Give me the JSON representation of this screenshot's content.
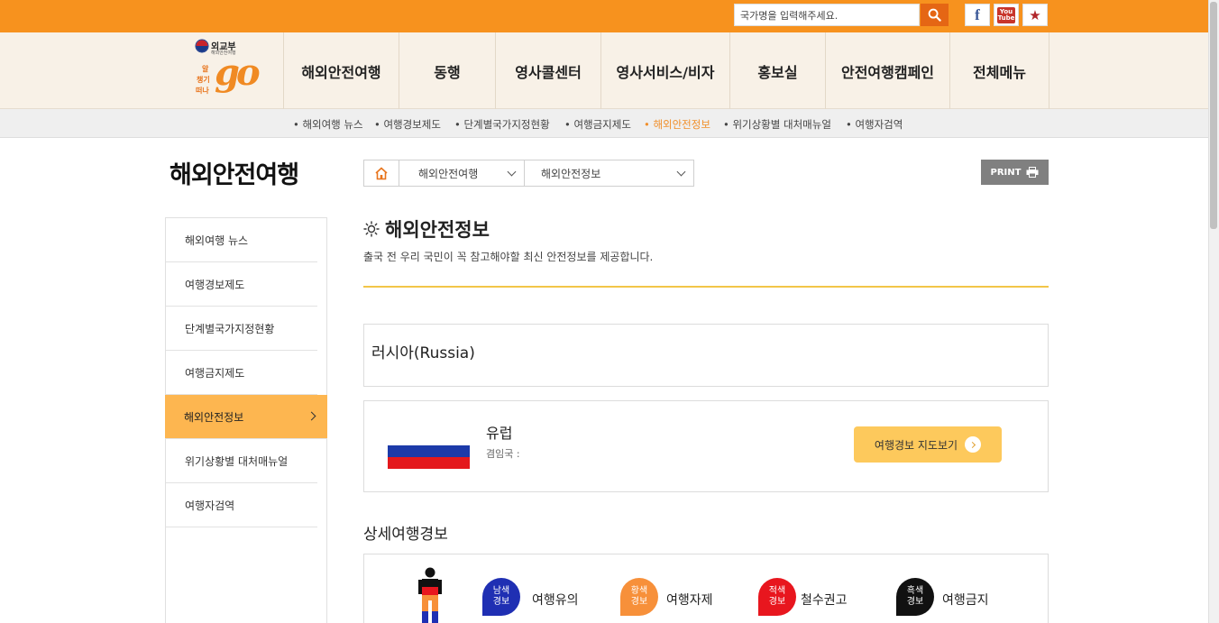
{
  "topbar": {
    "search_placeholder": "국가명을 입력해주세요.",
    "social": {
      "facebook": "f",
      "youtube_top": "You",
      "youtube_bottom": "Tube"
    }
  },
  "logo": {
    "ministry": "외교부",
    "ministry_sub": "해외안전여행",
    "slogan_chars": [
      "알",
      "챙기",
      "떠나"
    ],
    "go": "go"
  },
  "mainnav": [
    "해외안전여행",
    "동행",
    "영사콜센터",
    "영사서비스/비자",
    "홍보실",
    "안전여행캠페인",
    "전체메뉴"
  ],
  "subnav": [
    {
      "label": "• 해외여행 뉴스",
      "active": false
    },
    {
      "label": "• 여행경보제도",
      "active": false
    },
    {
      "label": "• 단계별국가지정현황",
      "active": false
    },
    {
      "label": "• 여행금지제도",
      "active": false
    },
    {
      "label": "• 해외안전정보",
      "active": true
    },
    {
      "label": "• 위기상황별 대처매뉴얼",
      "active": false
    },
    {
      "label": "• 여행자검역",
      "active": false
    }
  ],
  "page": {
    "title": "해외안전여행",
    "breadcrumb": [
      "해외안전여행",
      "해외안전정보"
    ],
    "print_label": "PRINT"
  },
  "sidebar": [
    {
      "label": "해외여행 뉴스",
      "active": false
    },
    {
      "label": "여행경보제도",
      "active": false
    },
    {
      "label": "단계별국가지정현황",
      "active": false
    },
    {
      "label": "여행금지제도",
      "active": false
    },
    {
      "label": "해외안전정보",
      "active": true
    },
    {
      "label": "위기상황별 대처매뉴얼",
      "active": false
    },
    {
      "label": "여행자검역",
      "active": false
    }
  ],
  "content": {
    "title": "해외안전정보",
    "description": "출국 전 우리 국민이 꼭 참고해야할 최신 안전정보를 제공합니다.",
    "country": "러시아(Russia)",
    "region": "유럽",
    "concurrent_label": "겸임국 :",
    "map_button": "여행경보 지도보기",
    "section_title": "상세여행경보",
    "levels": [
      {
        "badge_top": "남색",
        "badge_bottom": "경보",
        "label": "여행유의",
        "color": "#1f2fb3"
      },
      {
        "badge_top": "황색",
        "badge_bottom": "경보",
        "label": "여행자제",
        "color": "#f7903a"
      },
      {
        "badge_top": "적색",
        "badge_bottom": "경보",
        "label": "철수권고",
        "color": "#e8161e"
      },
      {
        "badge_top": "흑색",
        "badge_bottom": "경보",
        "label": "여행금지",
        "color": "#111111"
      }
    ]
  },
  "colors": {
    "accent": "#f7921e",
    "search_button": "#e56614",
    "active_menu": "#fdb650",
    "divider": "#f2c649"
  }
}
